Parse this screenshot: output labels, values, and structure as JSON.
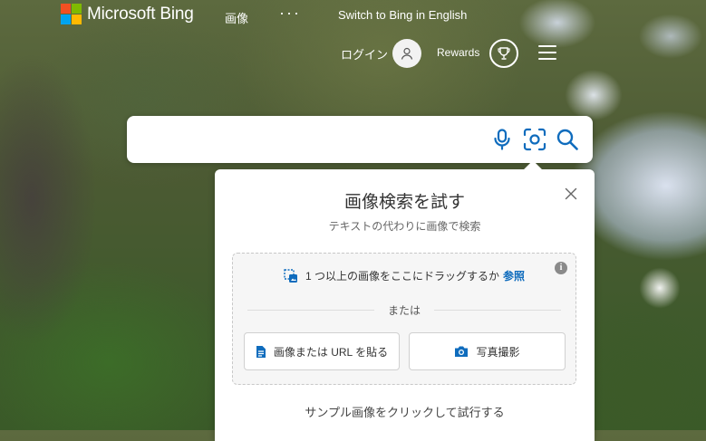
{
  "header": {
    "brand": "Microsoft Bing",
    "brand_colors": [
      "#f25022",
      "#7fba00",
      "#00a4ef",
      "#ffb900"
    ],
    "nav_images": "画像",
    "nav_more": "···",
    "switch_language": "Switch to Bing in English",
    "login": "ログイン",
    "rewards": "Rewards"
  },
  "search": {
    "value": "",
    "placeholder": "",
    "accent": "#0f6cbd",
    "icons": [
      "microphone-icon",
      "visual-search-icon",
      "search-icon"
    ]
  },
  "visual_search_panel": {
    "title": "画像検索を試す",
    "subtitle": "テキストの代わりに画像で検索",
    "drag_text": "1 つ以上の画像をここにドラッグするか",
    "browse_link": "参照",
    "or_text": "または",
    "paste_button": "画像または URL を貼る",
    "camera_button": "写真撮影",
    "sample_text": "サンプル画像をクリックして試行する"
  }
}
